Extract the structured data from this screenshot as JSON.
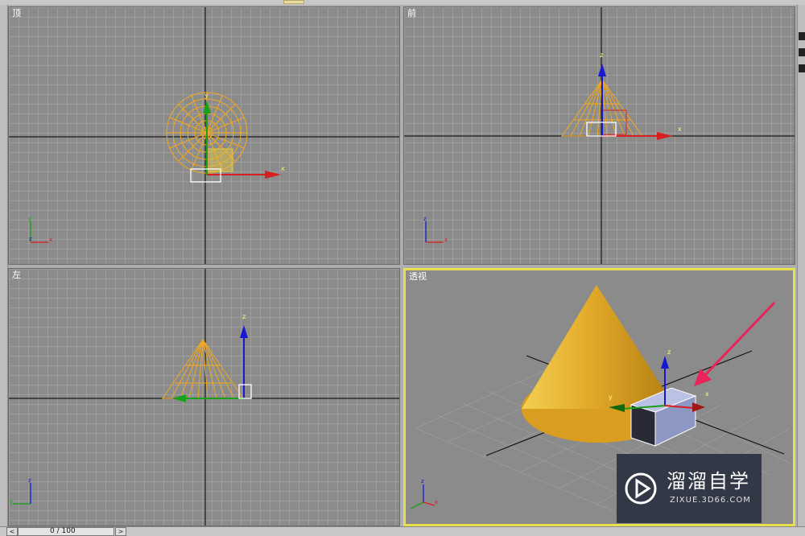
{
  "viewports": {
    "top": {
      "label": "顶"
    },
    "front": {
      "label": "前"
    },
    "left": {
      "label": "左"
    },
    "perspective": {
      "label": "透视"
    }
  },
  "axes": {
    "x": "x",
    "y": "y",
    "z": "z"
  },
  "timeline": {
    "frame_text": "0 / 100",
    "prev_icon": "<",
    "next_icon": ">"
  },
  "watermark": {
    "brand": "溜溜自学",
    "url": "ZIXUE.3D66.COM"
  },
  "colors": {
    "wireframe": "#f2a81e",
    "cone_fill": "#e6b32c",
    "axis_x": "#d81f1f",
    "axis_y": "#18a018",
    "axis_z": "#1818d0",
    "selection_box": "#ffffff",
    "active_border": "#e6e14a",
    "annotation_arrow": "#e8245a"
  },
  "icons": [
    "cone-wireframe-icon",
    "transform-gizmo-icon",
    "view-axis-tripod-icon",
    "annotation-arrow-icon",
    "play-logo-icon"
  ]
}
